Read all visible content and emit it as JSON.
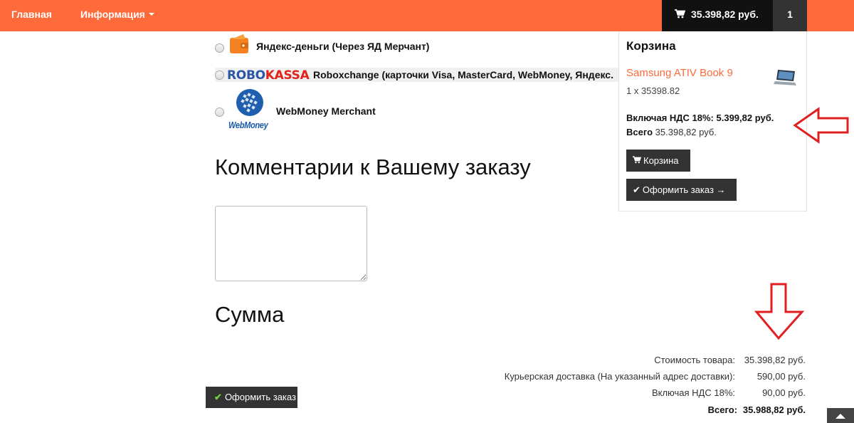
{
  "nav": {
    "home": "Главная",
    "info": "Информация",
    "cart_total": "35.398,82 руб.",
    "cart_count": "1"
  },
  "payments": [
    {
      "label": "Яндекс-деньги (Через ЯД Мерчант)",
      "icon": "yandex-money-icon"
    },
    {
      "label": "Roboxchange (карточки Visa, MasterCard, WebMoney, Яндекс.",
      "icon": "robokassa-logo",
      "logo_text_a": "ROBO",
      "logo_text_b": "KASSA"
    },
    {
      "label": "WebMoney Merchant",
      "icon": "webmoney-logo",
      "logo_text": "WebMoney"
    }
  ],
  "comments": {
    "heading": "Комментарии к Вашему заказу",
    "value": ""
  },
  "sum": {
    "heading": "Сумма",
    "rows": [
      {
        "label": "Стоимость товара:",
        "value": "35.398,82 руб."
      },
      {
        "label": "Курьерская доставка (На указанный адрес доставки):",
        "value": "590,00 руб."
      },
      {
        "label": "Включая НДС 18%:",
        "value": "90,00 руб."
      },
      {
        "label": "Всего:",
        "value": "35.988,82 руб."
      }
    ]
  },
  "order_button": "Оформить заказ",
  "mini_cart": {
    "title": "Корзина",
    "product": "Samsung ATIV Book 9",
    "qty": "1 x 35398.82",
    "vat": "Включая НДС 18%: 5.399,82 руб.",
    "total_label": "Всего",
    "total_value": "35.398,82 руб.",
    "cart_button": "Корзина",
    "checkout_button": "Оформить заказ →"
  },
  "colors": {
    "accent": "#ff6a3b",
    "dark": "#333333",
    "annotation": "#e02020"
  }
}
